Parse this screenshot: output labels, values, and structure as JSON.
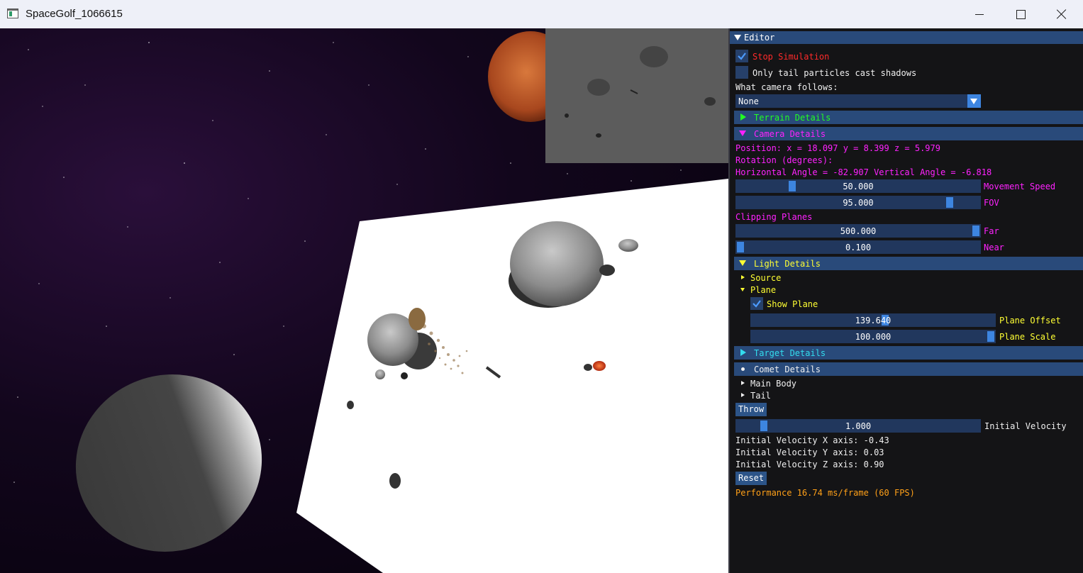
{
  "window": {
    "title": "SpaceGolf_1066615"
  },
  "editor": {
    "title": "Editor",
    "stop_simulation": {
      "label": "Stop Simulation",
      "checked": true
    },
    "tail_shadows": {
      "label": "Only tail particles cast shadows",
      "checked": false
    },
    "camera_follows": {
      "label": "What camera follows:",
      "selected": "None"
    },
    "terrain": {
      "label": "Terrain Details"
    },
    "camera": {
      "label": "Camera Details",
      "position": "Position: x = 18.097 y = 8.399 z = 5.979",
      "rotation_label": "Rotation (degrees):",
      "angles": "Horizontal Angle = -82.907 Vertical Angle = -6.818",
      "movement_speed": {
        "value": "50.000",
        "label": "Movement Speed",
        "fraction": 0.22
      },
      "fov": {
        "value": "95.000",
        "label": "FOV",
        "fraction": 0.89
      },
      "clipping_label": "Clipping Planes",
      "far": {
        "value": "500.000",
        "label": "Far",
        "fraction": 1.0
      },
      "near": {
        "value": "0.100",
        "label": "Near",
        "fraction": 0.0
      }
    },
    "light": {
      "label": "Light Details",
      "source": "Source",
      "plane": "Plane",
      "show_plane": {
        "label": "Show Plane",
        "checked": true
      },
      "plane_offset": {
        "value": "139.640",
        "label": "Plane Offset",
        "fraction": 0.55
      },
      "plane_scale": {
        "value": "100.000",
        "label": "Plane Scale",
        "fraction": 1.0
      }
    },
    "target": {
      "label": "Target Details"
    },
    "comet": {
      "label": "Comet Details",
      "main_body": "Main Body",
      "tail": "Tail",
      "throw_label": "Throw",
      "initial_velocity": {
        "value": "1.000",
        "label": "Initial Velocity",
        "fraction": 0.1
      },
      "vx": "Initial Velocity X axis: -0.43",
      "vy": "Initial Velocity Y axis: 0.03",
      "vz": "Initial Velocity Z axis: 0.90",
      "reset_label": "Reset"
    },
    "performance": "Performance 16.74 ms/frame (60 FPS)"
  },
  "colors": {
    "panel_bg": "#141416",
    "header_bg": "#294a7a",
    "slider_bg": "#21375d",
    "accent": "#3d85e0",
    "camera_text": "#ff22ff",
    "light_text": "#ffff33",
    "terrain_text": "#22ff22",
    "target_text": "#33ddee",
    "stop_text": "#ff2a2a",
    "performance_text": "#ffa018"
  }
}
